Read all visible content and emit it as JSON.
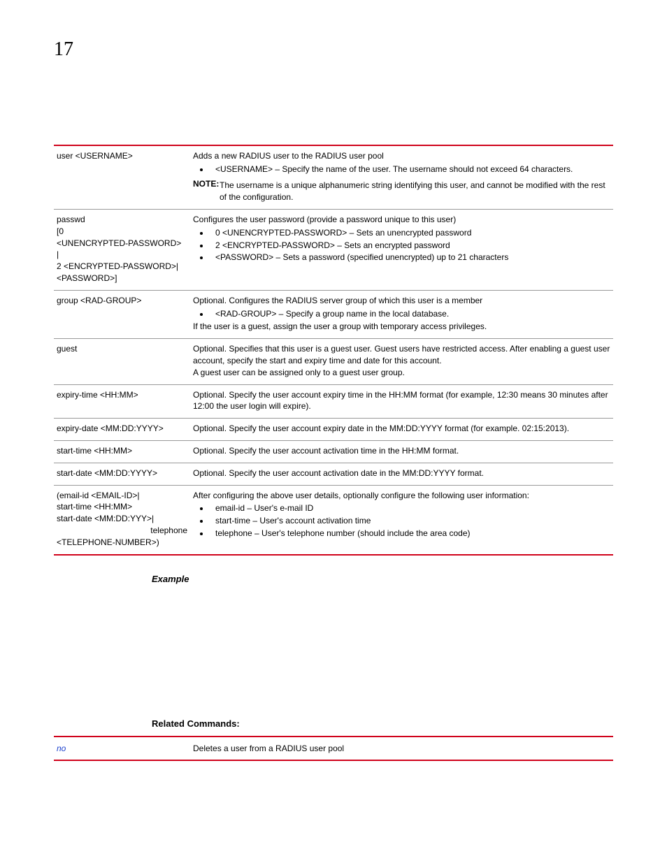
{
  "page_number": "17",
  "table": [
    {
      "left": "user <USERNAME>",
      "intro": "Adds a new RADIUS user to the RADIUS user pool",
      "bullets": [
        "<USERNAME> – Specify the name of the user. The username should not exceed 64 characters."
      ],
      "note_label": "NOTE:",
      "note": "The username is a unique alphanumeric string identifying this user, and cannot be modified with the rest of the configuration."
    },
    {
      "left_lines": [
        "passwd",
        "[0",
        "<UNENCRYPTED-PASSWORD>",
        "|",
        "2 <ENCRYPTED-PASSWORD>|",
        "<PASSWORD>]"
      ],
      "intro": "Configures the user password (provide a password unique to this user)",
      "bullets": [
        "0 <UNENCRYPTED-PASSWORD> – Sets an unencrypted password",
        "2 <ENCRYPTED-PASSWORD> – Sets an encrypted password",
        "<PASSWORD> – Sets a password (specified unencrypted) up to 21 characters"
      ]
    },
    {
      "left": "group <RAD-GROUP>",
      "intro": "Optional. Configures the RADIUS server group of which this user is a member",
      "bullets": [
        "<RAD-GROUP> – Specify a group name in the local database."
      ],
      "post": "If the user is a guest, assign the user a group with temporary access privileges."
    },
    {
      "left": "guest",
      "paras": [
        "Optional. Specifies that this user is a guest user. Guest users have restricted access. After enabling a guest user account, specify the start and expiry time and date for this account.",
        "A guest user can be assigned only to a guest user group."
      ]
    },
    {
      "left": "expiry-time <HH:MM>",
      "paras": [
        "Optional. Specify the user account expiry time in the HH:MM format (for example, 12:30 means 30 minutes after 12:00 the user login will expire)."
      ]
    },
    {
      "left": "expiry-date <MM:DD:YYYY>",
      "paras": [
        "Optional. Specify the user account expiry date in the MM:DD:YYYY format (for example. 02:15:2013)."
      ]
    },
    {
      "left": "start-time <HH:MM>",
      "paras": [
        "Optional. Specify the user account activation time in the HH:MM format."
      ]
    },
    {
      "left": "start-date <MM:DD:YYYY>",
      "paras": [
        "Optional. Specify the user account activation date in the MM:DD:YYYY format."
      ]
    },
    {
      "left_lines": [
        "(email-id <EMAIL-ID>|",
        "start-time <HH:MM>",
        "start-date <MM:DD:YYY>|"
      ],
      "left_right": "telephone",
      "left_after": "<TELEPHONE-NUMBER>)",
      "intro": "After configuring the above user details, optionally configure the following user information:",
      "bullets": [
        "email-id – User's e-mail ID",
        "start-time – User's account activation time",
        "telephone – User's telephone number (should include the area code)"
      ]
    }
  ],
  "example_heading": "Example",
  "related_heading": "Related Commands:",
  "related": [
    {
      "cmd": "no",
      "desc": "Deletes a user from a RADIUS user pool"
    }
  ]
}
